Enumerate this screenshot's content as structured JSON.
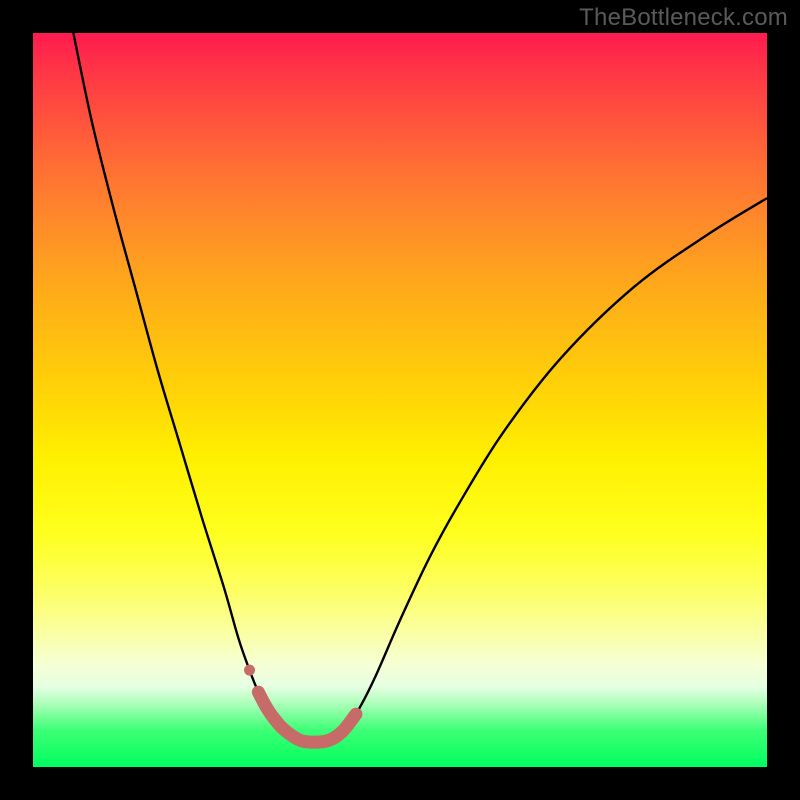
{
  "watermark_text": "TheBottleneck.com",
  "chart_data": {
    "type": "line",
    "title": "",
    "xlabel": "",
    "ylabel": "",
    "x_range_pct": [
      0,
      100
    ],
    "y_range_pct": [
      0,
      100
    ],
    "note": "Axes are unlabeled; values are read as percentages of the plot area. x is left→right, y is bottom→top (both 0–100).",
    "series": [
      {
        "name": "curve",
        "stroke": "#000000",
        "stroke_width": 2.4,
        "x": [
          5.5,
          8,
          11,
          14,
          17,
          20,
          23,
          26,
          28,
          29.5,
          30.7,
          31.7,
          32.7,
          34.2,
          36.5,
          39.0,
          40.7,
          42.3,
          44.0,
          46.5,
          50,
          54,
          58,
          64,
          72,
          82,
          92,
          100
        ],
        "y": [
          100,
          88,
          76,
          65,
          54,
          44,
          34,
          24.5,
          17.5,
          13.2,
          10.2,
          8.3,
          6.8,
          5.1,
          3.6,
          3.4,
          3.8,
          5.0,
          7.2,
          12.0,
          20.0,
          28.5,
          35.8,
          45.5,
          55.8,
          65.5,
          72.6,
          77.5
        ]
      },
      {
        "name": "highlight-segment",
        "stroke": "#c66b67",
        "stroke_width": 13,
        "linecap": "round",
        "x": [
          30.7,
          31.7,
          32.7,
          34.2,
          36.5,
          39.0,
          40.7,
          42.3,
          44.0
        ],
        "y": [
          10.2,
          8.3,
          6.8,
          5.1,
          3.6,
          3.4,
          3.8,
          5.0,
          7.2
        ]
      }
    ],
    "markers": [
      {
        "name": "dot",
        "x": 29.5,
        "y": 13.2,
        "r": 5.5,
        "fill": "#c66b67"
      }
    ],
    "colors": {
      "page_bg": "#000000",
      "curve": "#000000",
      "highlight": "#c66b67",
      "watermark": "#5a5a5a",
      "gradient_top": "#ff1a50",
      "gradient_bottom": "#00ff5e"
    }
  }
}
